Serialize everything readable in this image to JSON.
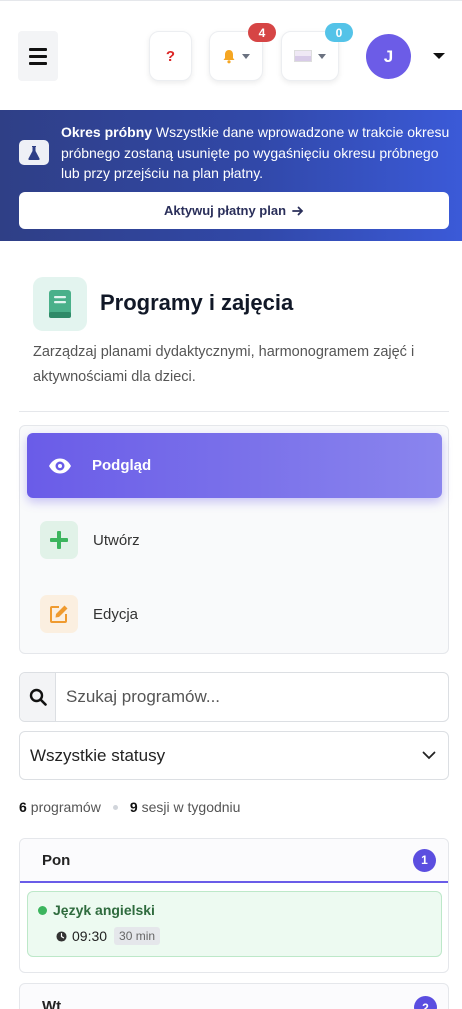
{
  "header": {
    "help_label": "?",
    "notifications_count": "4",
    "messages_count": "0",
    "avatar_initial": "J"
  },
  "trial": {
    "title": "Okres próbny",
    "message": "Wszystkie dane wprowadzone w trakcie okresu próbnego zostaną usunięte po wygaśnięciu okresu próbnego lub przy przejściu na plan płatny.",
    "cta_label": "Aktywuj płatny plan"
  },
  "page": {
    "title": "Programy i zajęcia",
    "description": "Zarządzaj planami dydaktycznymi, harmonogramem zajęć i aktywnościami dla dzieci."
  },
  "menu": {
    "items": [
      {
        "label": "Podgląd",
        "icon": "eye-icon"
      },
      {
        "label": "Utwórz",
        "icon": "plus-icon"
      },
      {
        "label": "Edycja",
        "icon": "edit-icon"
      }
    ]
  },
  "search": {
    "placeholder": "Szukaj programów..."
  },
  "filter": {
    "selected": "Wszystkie statusy"
  },
  "stats": {
    "programs_count": "6",
    "programs_label": "programów",
    "sessions_count": "9",
    "sessions_label": "sesji w tygodniu"
  },
  "schedule": {
    "days": [
      {
        "name": "Pon",
        "count": "1",
        "sessions": [
          {
            "title": "Język angielski",
            "time": "09:30",
            "duration": "30 min"
          }
        ]
      },
      {
        "name": "Wt",
        "count": "2"
      }
    ]
  },
  "colors": {
    "accent": "#6a5ce8",
    "trial_banner": "#3148a8",
    "session_green": "#3cb55e",
    "danger": "#d64545",
    "info": "#54c3e8"
  }
}
